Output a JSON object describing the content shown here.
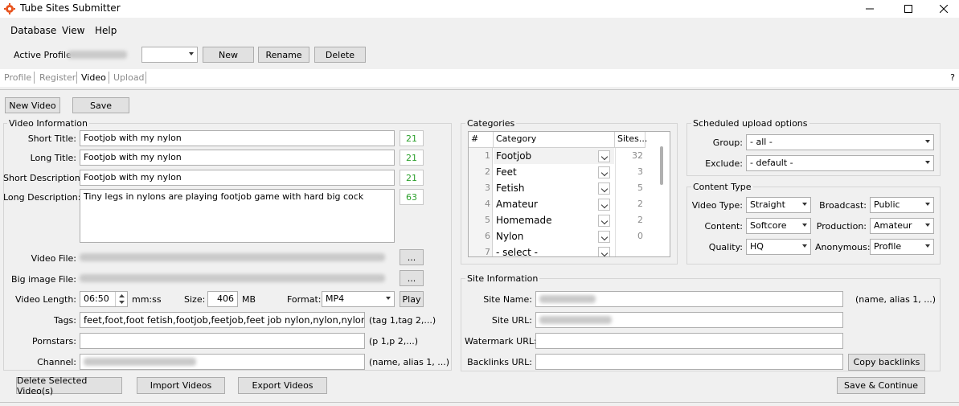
{
  "app": {
    "title": "Tube Sites Submitter",
    "window_controls": {
      "minimize": "minimize-icon",
      "maximize": "maximize-icon",
      "close": "close-icon"
    }
  },
  "menu": [
    "Database",
    "View",
    "Help"
  ],
  "profile": {
    "label": "Active Profile",
    "buttons": {
      "new": "New",
      "rename": "Rename",
      "delete": "Delete"
    }
  },
  "tabs": [
    {
      "label": "Profile",
      "active": false
    },
    {
      "label": "Register",
      "active": false
    },
    {
      "label": "Video",
      "active": true
    },
    {
      "label": "Upload",
      "active": false
    }
  ],
  "help_label": "?",
  "toolbar": {
    "new_video": "New Video",
    "save": "Save"
  },
  "video_info": {
    "title": "Video Information",
    "short_title": {
      "label": "Short Title:",
      "value": "Footjob with my nylon",
      "count": "21"
    },
    "long_title": {
      "label": "Long Title:",
      "value": "Footjob with my nylon",
      "count": "21"
    },
    "short_desc": {
      "label": "Short Description:",
      "value": "Footjob with my nylon",
      "count": "21"
    },
    "long_desc": {
      "label": "Long Description:",
      "value": "Tiny legs in nylons are playing footjob game with hard big cock",
      "count": "63"
    },
    "video_file": {
      "label": "Video File:",
      "browse": "..."
    },
    "big_image": {
      "label": "Big image File:",
      "browse": "..."
    },
    "length": {
      "label": "Video Length:",
      "value": "06:50",
      "unit": "mm:ss"
    },
    "size": {
      "label": "Size:",
      "value": "406",
      "unit": "MB"
    },
    "format": {
      "label": "Format:",
      "value": "MP4",
      "play": "Play"
    },
    "tags": {
      "label": "Tags:",
      "value": "feet,foot,foot fetish,footjob,feetjob,feet job nylon,nylon,nylons,lingeri",
      "hint": "(tag 1,tag 2,...)"
    },
    "pornstars": {
      "label": "Pornstars:",
      "value": "",
      "hint": "(p 1,p 2,...)"
    },
    "channel": {
      "label": "Channel:",
      "hint": "(name, alias 1, ...)"
    }
  },
  "categories": {
    "title": "Categories",
    "headers": {
      "num": "#",
      "category": "Category",
      "sites": "Sites..."
    },
    "rows": [
      {
        "num": "1",
        "category": "Footjob",
        "sites": "32"
      },
      {
        "num": "2",
        "category": "Feet",
        "sites": "3"
      },
      {
        "num": "3",
        "category": "Fetish",
        "sites": "5"
      },
      {
        "num": "4",
        "category": "Amateur",
        "sites": "2"
      },
      {
        "num": "5",
        "category": "Homemade",
        "sites": "2"
      },
      {
        "num": "6",
        "category": "Nylon",
        "sites": "0"
      },
      {
        "num": "7",
        "category": "- select -",
        "sites": ""
      }
    ]
  },
  "scheduled": {
    "title": "Scheduled upload options",
    "group": {
      "label": "Group:",
      "value": "- all -"
    },
    "exclude": {
      "label": "Exclude:",
      "value": "- default -"
    }
  },
  "content_type": {
    "title": "Content Type",
    "video_type": {
      "label": "Video Type:",
      "value": "Straight"
    },
    "broadcast": {
      "label": "Broadcast:",
      "value": "Public"
    },
    "content": {
      "label": "Content:",
      "value": "Softcore"
    },
    "production": {
      "label": "Production:",
      "value": "Amateur"
    },
    "quality": {
      "label": "Quality:",
      "value": "HQ"
    },
    "anonymous": {
      "label": "Anonymous:",
      "value": "Profile"
    }
  },
  "site_info": {
    "title": "Site Information",
    "site_name": {
      "label": "Site Name:",
      "hint": "(name, alias 1, ...)"
    },
    "site_url": {
      "label": "Site URL:"
    },
    "watermark_url": {
      "label": "Watermark URL:",
      "value": ""
    },
    "backlinks_url": {
      "label": "Backlinks URL:",
      "value": "",
      "copy": "Copy backlinks"
    }
  },
  "footer": {
    "delete_selected": "Delete Selected Video(s)",
    "import": "Import Videos",
    "export": "Export Videos",
    "save_continue": "Save & Continue"
  }
}
